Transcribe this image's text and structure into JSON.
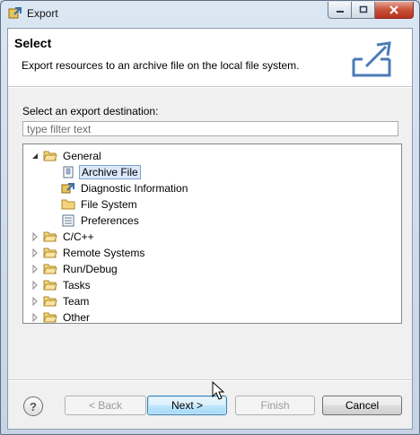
{
  "window": {
    "title": "Export"
  },
  "header": {
    "title": "Select",
    "description": "Export resources to an archive file on the local file system."
  },
  "destination": {
    "label": "Select an export destination:",
    "filter_placeholder": "type filter text"
  },
  "tree": {
    "general": "General",
    "archive_file": "Archive File",
    "diagnostic_information": "Diagnostic Information",
    "file_system": "File System",
    "preferences": "Preferences",
    "cpp": "C/C++",
    "remote_systems": "Remote Systems",
    "run_debug": "Run/Debug",
    "tasks": "Tasks",
    "team": "Team",
    "other": "Other"
  },
  "buttons": {
    "help": "?",
    "back": "< Back",
    "next": "Next >",
    "finish": "Finish",
    "cancel": "Cancel"
  }
}
